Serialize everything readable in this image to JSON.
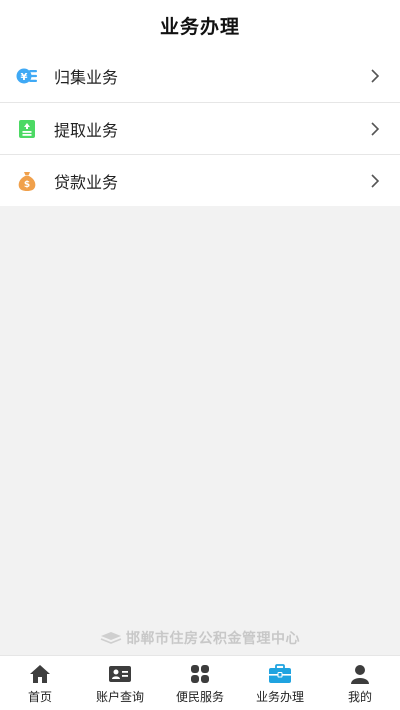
{
  "header": {
    "title": "业务办理"
  },
  "menu": {
    "items": [
      {
        "label": "归集业务",
        "icon": "coin-stack-icon",
        "color": "#3fa9f5"
      },
      {
        "label": "提取业务",
        "icon": "withdraw-card-icon",
        "color": "#4cd964"
      },
      {
        "label": "贷款业务",
        "icon": "money-bag-icon",
        "color": "#f0a04b"
      }
    ]
  },
  "footer": {
    "brand": "邯郸市住房公积金管理中心"
  },
  "tabbar": {
    "active_color": "#1fa3e0",
    "inactive_color": "#3d3d3d",
    "items": [
      {
        "label": "首页",
        "icon": "home-icon"
      },
      {
        "label": "账户查询",
        "icon": "id-card-icon"
      },
      {
        "label": "便民服务",
        "icon": "grid-icon"
      },
      {
        "label": "业务办理",
        "icon": "briefcase-icon",
        "active": true
      },
      {
        "label": "我的",
        "icon": "user-icon"
      }
    ]
  }
}
